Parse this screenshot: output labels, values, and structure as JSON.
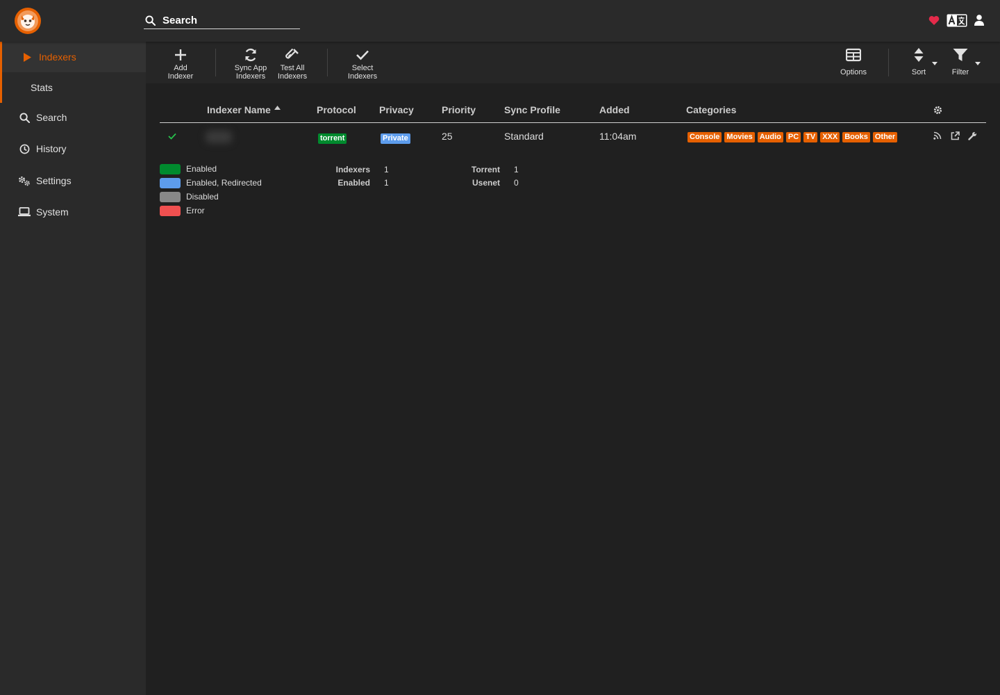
{
  "header": {
    "search_placeholder": "Search"
  },
  "sidebar": {
    "items": [
      {
        "label": "Indexers"
      },
      {
        "label": "Stats"
      },
      {
        "label": "Search"
      },
      {
        "label": "History"
      },
      {
        "label": "Settings"
      },
      {
        "label": "System"
      }
    ]
  },
  "toolbar": {
    "add_line1": "Add",
    "add_line2": "Indexer",
    "sync_line1": "Sync App",
    "sync_line2": "Indexers",
    "test_line1": "Test All",
    "test_line2": "Indexers",
    "select_line1": "Select",
    "select_line2": "Indexers",
    "options": "Options",
    "sort": "Sort",
    "filter": "Filter"
  },
  "table": {
    "columns": [
      "Indexer Name",
      "Protocol",
      "Privacy",
      "Priority",
      "Sync Profile",
      "Added",
      "Categories"
    ],
    "rows": [
      {
        "protocol": "torrent",
        "privacy": "Private",
        "priority": "25",
        "sync_profile": "Standard",
        "added": "11:04am",
        "categories": [
          "Console",
          "Movies",
          "Audio",
          "PC",
          "TV",
          "XXX",
          "Books",
          "Other"
        ]
      }
    ]
  },
  "legend": [
    {
      "label": "Enabled",
      "color": "#008a2e"
    },
    {
      "label": "Enabled, Redirected",
      "color": "#5d9cec"
    },
    {
      "label": "Disabled",
      "color": "#888888"
    },
    {
      "label": "Error",
      "color": "#f05050"
    }
  ],
  "stats": {
    "indexers_label": "Indexers",
    "indexers_value": "1",
    "enabled_label": "Enabled",
    "enabled_value": "1",
    "torrent_label": "Torrent",
    "torrent_value": "1",
    "usenet_label": "Usenet",
    "usenet_value": "0"
  },
  "colors": {
    "accent": "#e66000",
    "torrent_badge": "#008a2e",
    "private_badge": "#5d9cec"
  }
}
